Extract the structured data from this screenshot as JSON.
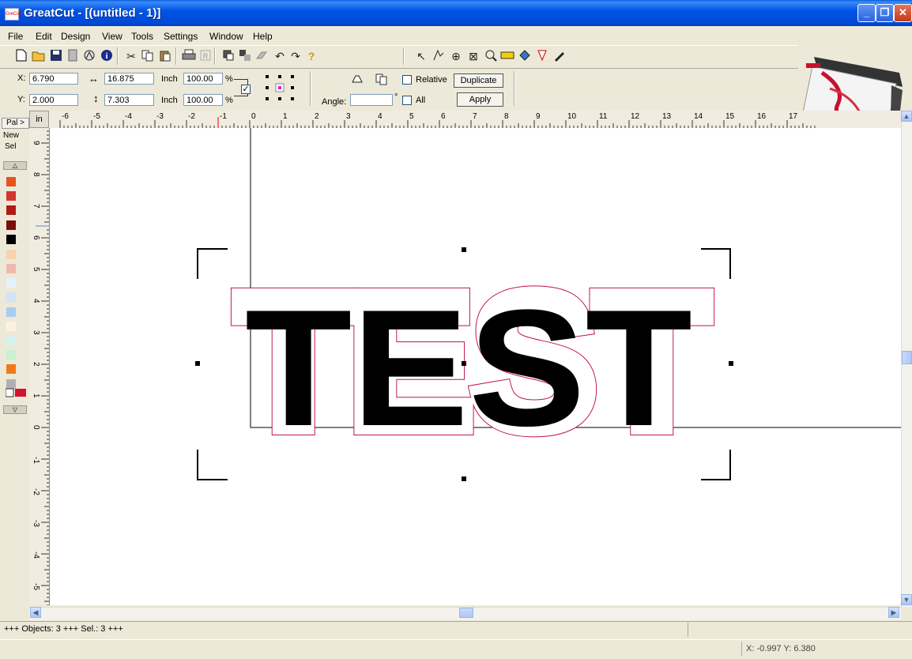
{
  "window": {
    "app_name": "GreatCut",
    "doc_title": " - [(untitled - 1)]",
    "icon_text": "GreCut",
    "minimize": "_",
    "restore": "❐",
    "close": "✕"
  },
  "menu": [
    "File",
    "Edit",
    "Design",
    "View",
    "Tools",
    "Settings",
    "Window",
    "Help"
  ],
  "props": {
    "x_label": "X:",
    "x_value": "6.790",
    "y_label": "Y:",
    "y_value": "2.000",
    "width_value": "16.875",
    "height_value": "7.303",
    "unit1": "Inch",
    "unit2": "Inch",
    "scale_w": "100.00",
    "scale_h": "100.00",
    "pct1": "%",
    "pct2": "%",
    "relative_label": "Relative",
    "duplicate_label": "Duplicate",
    "angle_label": "Angle:",
    "angle_value": "",
    "deg": "°",
    "all_label": "All",
    "apply_label": "Apply"
  },
  "palette": {
    "pal_label": "Pal >",
    "new_label": "New",
    "sel_label": "Sel",
    "colors": [
      "#e8531c",
      "#d4352c",
      "#b31a14",
      "#7b0e0a",
      "#000000",
      "#f8d2b0",
      "#f2b8b0",
      "#e5f1fb",
      "#cfe4f7",
      "#a9cdf0",
      "#fdf2e0",
      "#d6f3ea",
      "#c9f1cf",
      "#f07a18",
      "#b0b0b0"
    ]
  },
  "ruler": {
    "unit": "in",
    "h_labels": [
      "-6",
      "-5",
      "-4",
      "-3",
      "-2",
      "-1",
      "0",
      "1",
      "2",
      "3",
      "4",
      "5",
      "6",
      "7",
      "8",
      "9",
      "10",
      "11",
      "12",
      "13",
      "14",
      "15",
      "16",
      "17"
    ],
    "v_labels": [
      "9",
      "8",
      "7",
      "6",
      "5",
      "4",
      "3",
      "2",
      "1",
      "0",
      "-1",
      "-2",
      "-3",
      "-4",
      "-5"
    ]
  },
  "canvas": {
    "text": "TEST"
  },
  "status": {
    "objects": "+++ Objects: 3 +++ Sel.: 3 +++",
    "coords": "X: -0.997 Y: 6.380"
  }
}
